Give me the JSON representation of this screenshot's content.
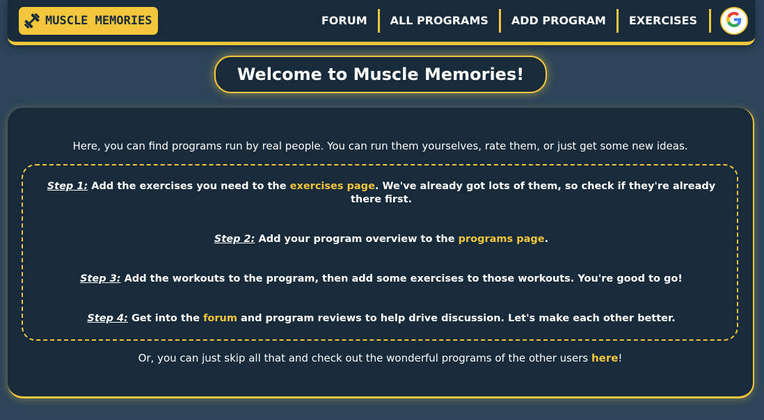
{
  "navbar": {
    "logo_text": "MUSCLE MEMORIES",
    "logo_icon": "dumbbell-icon",
    "links": [
      "FORUM",
      "ALL PROGRAMS",
      "ADD PROGRAM",
      "EXERCISES"
    ],
    "google_icon": "google-icon"
  },
  "title": "Welcome to Muscle Memories!",
  "intro": "Here, you can find programs run by real people. You can run them yourselves, rate them, or just get some new ideas.",
  "steps": [
    {
      "label": "Step 1:",
      "before": " Add the exercises you need to the ",
      "link": "exercises page",
      "after": ". We've already got lots of them, so check if they're already there first."
    },
    {
      "label": "Step 2:",
      "before": " Add your program overview to the ",
      "link": "programs page",
      "after": "."
    },
    {
      "label": "Step 3:",
      "before": " Add the workouts to the program, then add some exercises to those workouts. You're good to go!",
      "link": "",
      "after": ""
    },
    {
      "label": "Step 4:",
      "before": " Get into the ",
      "link": "forum",
      "after": " and program reviews to help drive discussion. Let's make each other better."
    }
  ],
  "outro": {
    "before": "Or, you can just skip all that and check out the wonderful programs of the other users ",
    "link": "here",
    "after": "!"
  },
  "colors": {
    "background": "#2b4459",
    "card": "#182b3a",
    "accent": "#f3c63b",
    "text": "#ffffff"
  }
}
